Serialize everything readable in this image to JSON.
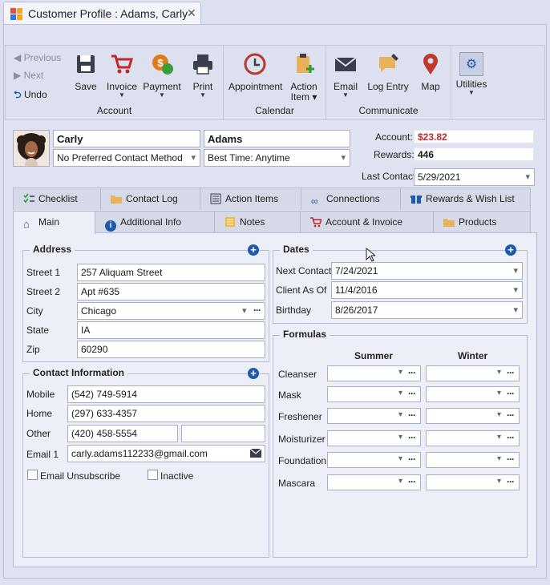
{
  "window": {
    "title": "Customer Profile : Adams, Carly",
    "close": "✕"
  },
  "ribbon": {
    "nav": {
      "previous": "Previous",
      "next": "Next",
      "undo": "Undo"
    },
    "account": {
      "label": "Account",
      "save": "Save",
      "invoice": "Invoice",
      "payment": "Payment",
      "print": "Print"
    },
    "calendar": {
      "label": "Calendar",
      "appointment": "Appointment",
      "action_item_line1": "Action",
      "action_item_line2": "Item ▾"
    },
    "communicate": {
      "label": "Communicate",
      "email": "Email",
      "log_entry": "Log Entry",
      "map": "Map"
    },
    "utilities": {
      "label": "Utilities"
    }
  },
  "customer": {
    "first_name": "Carly",
    "last_name": "Adams",
    "contact_method": "No Preferred Contact Method",
    "best_time": "Best Time: Anytime",
    "account_label": "Account:",
    "account_value": "$23.82",
    "rewards_label": "Rewards:",
    "rewards_value": "446",
    "last_contact_label": "Last Contact",
    "last_contact_value": "5/29/2021"
  },
  "tabs_row1": [
    "Checklist",
    "Contact Log",
    "Action Items",
    "Connections",
    "Rewards & Wish List"
  ],
  "tabs_row2": [
    "Main",
    "Additional Info",
    "Notes",
    "Account & Invoice",
    "Products"
  ],
  "address": {
    "title": "Address",
    "street1_label": "Street 1",
    "street1": "257 Aliquam Street",
    "street2_label": "Street 2",
    "street2": "Apt #635",
    "city_label": "City",
    "city": "Chicago",
    "state_label": "State",
    "state": "IA",
    "zip_label": "Zip",
    "zip": "60290"
  },
  "contact": {
    "title": "Contact Information",
    "mobile_label": "Mobile",
    "mobile": "(542) 749-5914",
    "home_label": "Home",
    "home": "(297) 633-4357",
    "other_label": "Other",
    "other": "(420) 458-5554",
    "email_label": "Email 1",
    "email": "carly.adams112233@gmail.com",
    "unsubscribe_label": "Email Unsubscribe",
    "inactive_label": "Inactive"
  },
  "dates": {
    "title": "Dates",
    "next_contact_label": "Next Contact",
    "next_contact": "7/24/2021",
    "client_as_of_label": "Client As Of",
    "client_as_of": "11/4/2016",
    "birthday_label": "Birthday",
    "birthday": "8/26/2017"
  },
  "formulas": {
    "title": "Formulas",
    "col_summer": "Summer",
    "col_winter": "Winter",
    "rows": [
      "Cleanser",
      "Mask",
      "Freshener",
      "Moisturizer",
      "Foundation",
      "Mascara"
    ]
  },
  "ellipsis": "···",
  "plus": "+",
  "colors": {
    "accent_blue": "#1e5aa8",
    "account_red": "#c0262d",
    "invoice_red": "#c0262d",
    "payment_orange": "#e07b1a",
    "map_red": "#c0392b"
  }
}
